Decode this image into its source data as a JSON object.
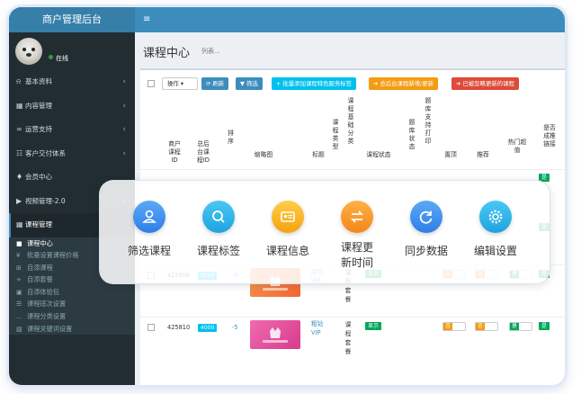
{
  "sidebar": {
    "brand": "商户管理后台",
    "user_status": "在线",
    "items": [
      {
        "label": "基本资料",
        "icon": "bell-icon",
        "glyph": "⍾",
        "chev": "‹"
      },
      {
        "label": "内容管理",
        "icon": "grid-icon",
        "glyph": "▦",
        "chev": "‹"
      },
      {
        "label": "运营支持",
        "icon": "link-icon",
        "glyph": "∞",
        "chev": "‹"
      },
      {
        "label": "客户交付体系",
        "icon": "users-icon",
        "glyph": "☷",
        "chev": "‹"
      },
      {
        "label": "会员中心",
        "icon": "member-icon",
        "glyph": "♦",
        "chev": ""
      },
      {
        "label": "视频管理-2.0",
        "icon": "video-icon",
        "glyph": "▶",
        "chev": "‹"
      },
      {
        "label": "课程管理",
        "icon": "grid-icon",
        "glyph": "▦",
        "chev": ""
      }
    ],
    "sub_items": [
      {
        "label": "课程中心",
        "glyph": "■"
      },
      {
        "label": "批量设置课程价格",
        "glyph": "¥"
      },
      {
        "label": "自添课程",
        "glyph": "⊞"
      },
      {
        "label": "自添套餐",
        "glyph": "+"
      },
      {
        "label": "自添体验包",
        "glyph": "▣"
      },
      {
        "label": "课程班次设置",
        "glyph": "☰"
      },
      {
        "label": "课程分类设置",
        "glyph": "…"
      },
      {
        "label": "课程关键词设置",
        "glyph": "▧"
      }
    ]
  },
  "topbar": {
    "menu_glyph": "≡"
  },
  "page": {
    "title": "课程中心",
    "subtitle": "列表..."
  },
  "toolbar": {
    "op_label": "操作",
    "refresh_label": "刷新",
    "filter_label": "筛选",
    "batch_tags_label": "批量添加课程特色服务标签",
    "update_new_label": "总后台课程新增/更新",
    "ignore_update_label": "已被忽略更新的课程"
  },
  "colors": {
    "refresh": "#3c8dbc",
    "filter": "#3c8dbc",
    "batch": "#00c0ef",
    "update": "#f39c12",
    "ignore": "#dd4b39",
    "shown": "#00a65a"
  },
  "columns": {
    "merchant_id": "商户课程ID",
    "master_id": "总后台课程ID",
    "sort": "排序",
    "thumb": "缩略图",
    "title": "标题",
    "type": "课程类型",
    "base_cat": "课程基础分类",
    "status": "课程状态",
    "bank_status": "题库状态",
    "bank_print": "题库支持打印",
    "top": "置顶",
    "recommend": "推荐",
    "hot": "热门超值",
    "link": "是否成推链接"
  },
  "rows": [
    {
      "merchant_id": "425808",
      "master_id": "3999",
      "sort": "-6",
      "title": "金钻",
      "vip": "VIP",
      "type_chars": [
        "课",
        "程",
        "套",
        "餐"
      ],
      "status": "显示",
      "toggle": "否",
      "link": "是"
    },
    {
      "merchant_id": "425810",
      "master_id": "4000",
      "sort": "-5",
      "title": "粗钻",
      "vip": "VIP",
      "type_chars": [
        "课",
        "程",
        "套",
        "餐"
      ],
      "status": "显示",
      "toggle": "否",
      "link": "是"
    }
  ],
  "link_values_top": [
    "是",
    "是"
  ],
  "features": [
    {
      "label": "筛选课程",
      "icon": "user-filter-icon",
      "from": "#5aa9f5",
      "to": "#2f7ee8"
    },
    {
      "label": "课程标签",
      "icon": "search-tag-icon",
      "from": "#4ac7f4",
      "to": "#1fa4e0"
    },
    {
      "label": "课程信息",
      "icon": "id-card-icon",
      "from": "#ffce4a",
      "to": "#f5a20f"
    },
    {
      "label": "课程更新时间",
      "label_lines": [
        "课程更",
        "新时间"
      ],
      "icon": "swap-icon",
      "from": "#ffb048",
      "to": "#f5861a"
    },
    {
      "label": "同步数据",
      "icon": "sync-icon",
      "from": "#5aa9f5",
      "to": "#2f7ee8"
    },
    {
      "label": "编辑设置",
      "icon": "gear-icon",
      "from": "#4ac7f4",
      "to": "#1fa4e0"
    }
  ]
}
